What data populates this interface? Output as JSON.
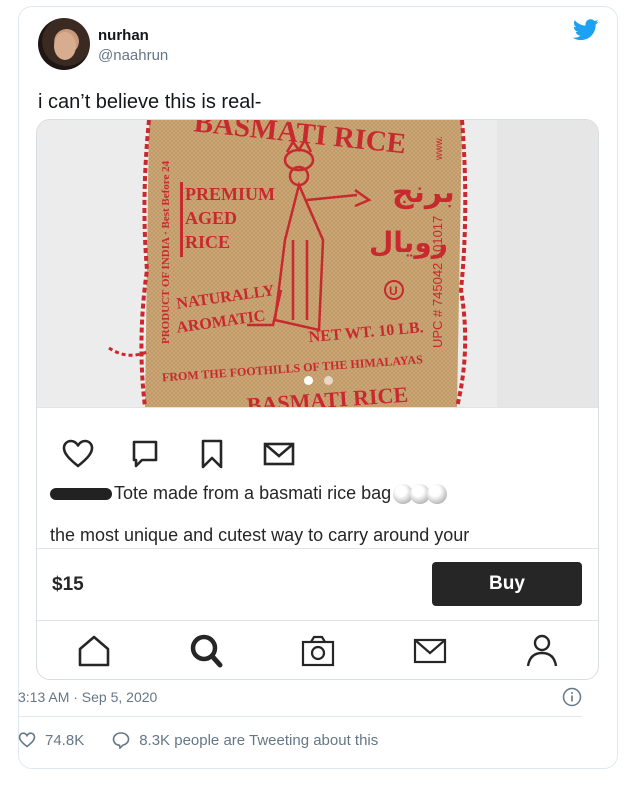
{
  "user": {
    "display_name": "nurhan",
    "handle": "@naahrun"
  },
  "tweet": {
    "text": "i can’t believe this is real-"
  },
  "embed": {
    "photo": {
      "bag_text": {
        "brand_top": "BASMATI RICE",
        "premium": "PREMIUM",
        "aged": "AGED",
        "rice": "RICE",
        "naturally": "NATURALLY",
        "aromatic": "AROMATIC",
        "net_wt": "NET WT. 10 LB.",
        "foothills": "FROM THE FOOTHILLS OF THE HIMALAYAS",
        "brand_bottom": "BASMATI RICE",
        "side_left": "PRODUCT OF INDIA · Best Before 24",
        "side_right": "UPC # 745042 101017",
        "side_top_right": "www.",
        "arabic_1": "برنج",
        "arabic_2": "رويال",
        "u_mark": "U"
      },
      "carousel_dots": 2,
      "active_dot": 0
    },
    "action_icons": [
      "heart-icon",
      "comment-icon",
      "bookmark-icon",
      "mail-icon"
    ],
    "caption": "Tote made from a basmati rice bag",
    "description": "the most unique and cutest way to carry around your",
    "price": "$15",
    "buy_label": "Buy",
    "nav_icons": [
      "home-icon",
      "search-icon",
      "camera-icon",
      "mail-icon",
      "profile-icon"
    ]
  },
  "meta": {
    "timestamp": "3:13 AM · Sep 5, 2020",
    "likes": "74.8K",
    "tweeting": "8.3K people are Tweeting about this"
  },
  "colors": {
    "twitter_blue": "#1da1f2",
    "burlap": "#c9a273",
    "print_red": "#c8292e",
    "buy_button": "#262626"
  }
}
